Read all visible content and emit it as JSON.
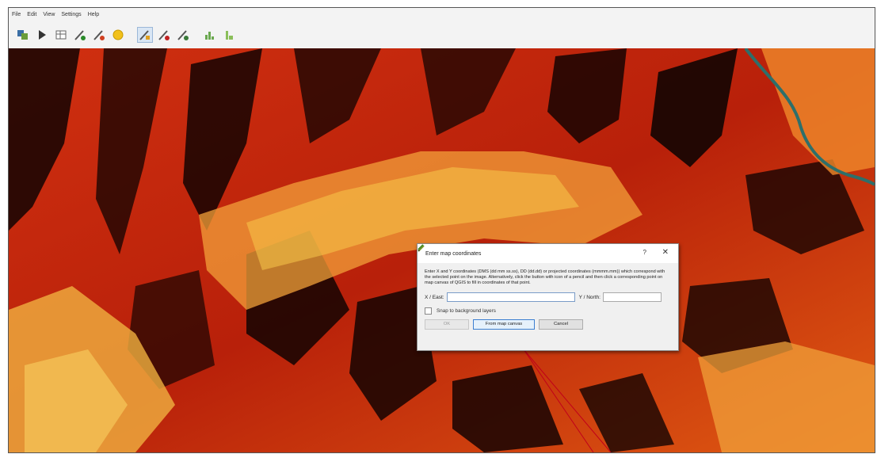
{
  "menu": [
    "File",
    "Edit",
    "View",
    "Settings",
    "Help"
  ],
  "toolbar": {
    "icons": [
      "map-layers-icon",
      "play-icon",
      "table-icon",
      "add-point-icon",
      "move-point-icon",
      "sun-icon",
      "select-point-icon",
      "delete-point-icon",
      "edit-point-icon",
      "histogram-icon",
      "chart-icon"
    ]
  },
  "dialog": {
    "title": "Enter map coordinates",
    "help": "?",
    "close": "✕",
    "description": "Enter X and Y coordinates (DMS (dd mm ss.ss), DD (dd.dd) or projected coordinates (mmmm.mm)) which correspond with the selected point on the image. Alternatively, click the button with icon of a pencil and then click a corresponding point on map canvas of QGIS to fill in coordinates of that point.",
    "x_label": "X / East:",
    "x_value": "",
    "y_label": "Y / North:",
    "y_value": "",
    "snap_label": "Snap to background layers",
    "ok_label": "OK",
    "from_map_label": "From map canvas",
    "cancel_label": "Cancel"
  },
  "colors": {
    "canvas_dark": "#120402",
    "canvas_red": "#c0260a",
    "canvas_orange": "#f06a12",
    "canvas_yellow": "#f8c94a",
    "river": "#2e6f6a",
    "annotation": "#c0001a"
  }
}
